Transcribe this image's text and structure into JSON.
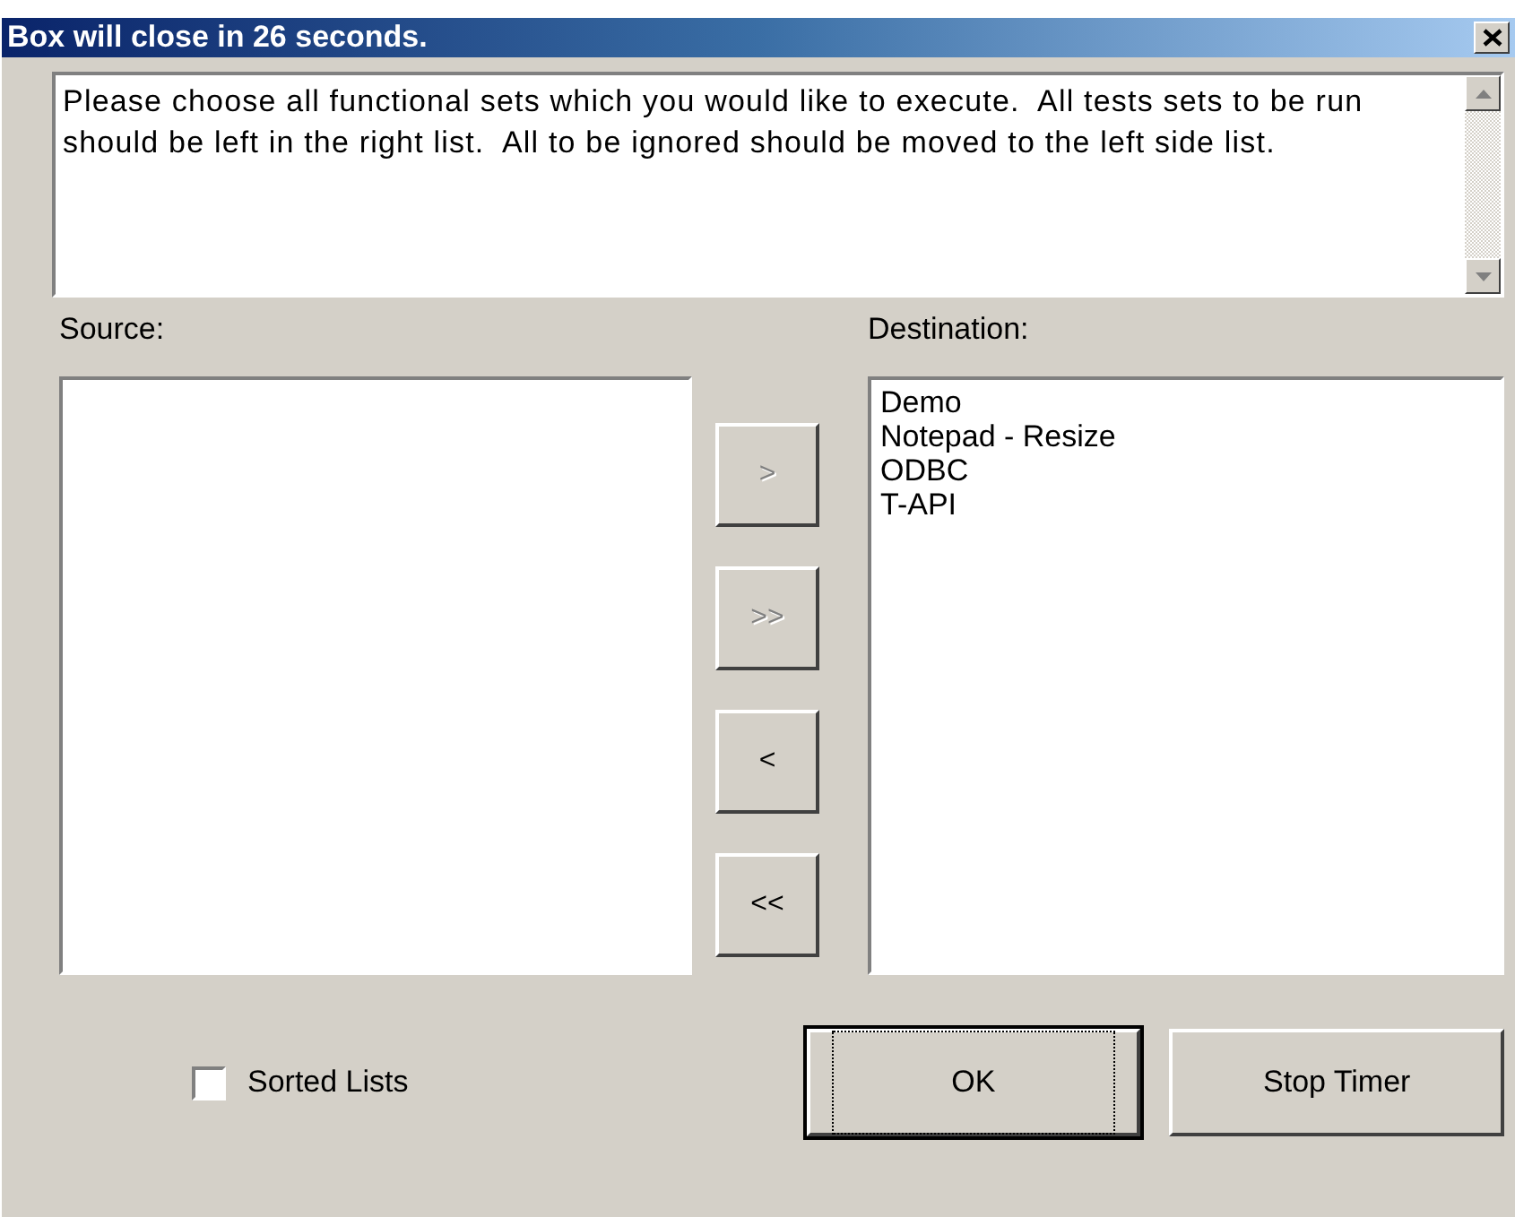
{
  "window": {
    "title": "Box will close in 26 seconds."
  },
  "message": "Please choose all functional sets which you would like to execute.  All tests sets to be run should be left in the right list.  All to be ignored should be moved to the left side list.",
  "source": {
    "label": "Source:"
  },
  "destination": {
    "label": "Destination:",
    "items": [
      "Demo",
      "Notepad - Resize",
      "ODBC",
      "T-API"
    ]
  },
  "move_buttons": [
    {
      "label": ">",
      "disabled": true
    },
    {
      "label": ">>",
      "disabled": true
    },
    {
      "label": "<",
      "disabled": false
    },
    {
      "label": "<<",
      "disabled": false
    }
  ],
  "sorted_lists": {
    "label": "Sorted Lists",
    "checked": false
  },
  "buttons": [
    {
      "label": "OK",
      "default": true
    },
    {
      "label": "Stop Timer",
      "default": false
    }
  ]
}
